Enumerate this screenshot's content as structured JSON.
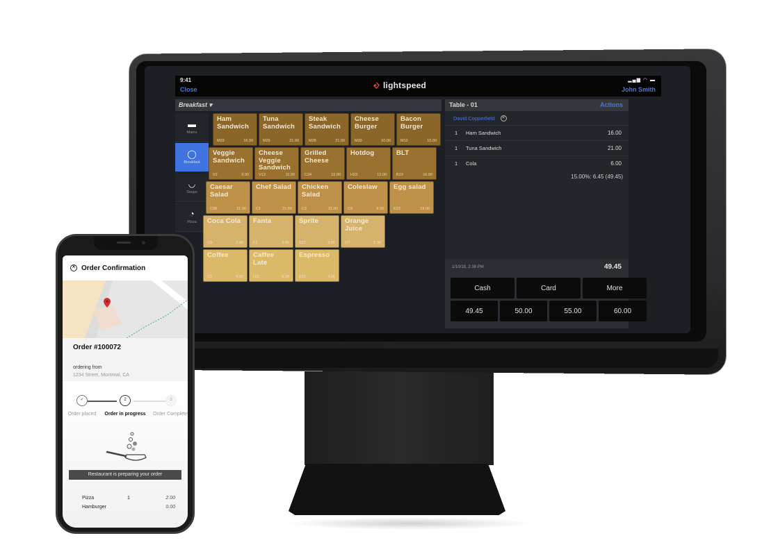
{
  "tablet": {
    "status_bar": {
      "time": "9:41",
      "icons": "signal-wifi-battery"
    },
    "header": {
      "close_label": "Close",
      "brand": "lightspeed",
      "user": "John Smith"
    },
    "menu": {
      "title": "Breakfast ▾"
    },
    "sidebar": {
      "items": [
        {
          "label": "Mains",
          "icon": "burger-icon",
          "glyph": "▬",
          "active": false
        },
        {
          "label": "Breakfast",
          "icon": "egg-icon",
          "glyph": "◯",
          "active": true
        },
        {
          "label": "Soups",
          "icon": "soup-bowl-icon",
          "glyph": "◡",
          "active": false
        },
        {
          "label": "Pizza",
          "icon": "pizza-icon",
          "glyph": "◔",
          "active": false
        }
      ]
    },
    "products": [
      [
        {
          "name": "Ham Sandwich",
          "code": "M23",
          "price": "16.00"
        },
        {
          "name": "Tuna Sandwich",
          "code": "M25",
          "price": "21.00"
        },
        {
          "name": "Steak Sandwich",
          "code": "M28",
          "price": "21.00"
        },
        {
          "name": "Cheese Burger",
          "code": "M39",
          "price": "10.00"
        },
        {
          "name": "Bacon Burger",
          "code": "M12",
          "price": "10.00"
        }
      ],
      [
        {
          "name": "Veggie Sandwich",
          "code": "V2",
          "price": "9.00"
        },
        {
          "name": "Cheese Veggie Sandwich",
          "code": "V13",
          "price": "11.00"
        },
        {
          "name": "Grilled Cheese",
          "code": "C34",
          "price": "12.00"
        },
        {
          "name": "Hotdog",
          "code": "H23",
          "price": "12.00"
        },
        {
          "name": "BLT",
          "code": "B19",
          "price": "16.00"
        }
      ],
      [
        {
          "name": "Caesar Salad",
          "code": "C99",
          "price": "21.00"
        },
        {
          "name": "Chef Salad",
          "code": "C1",
          "price": "21.50"
        },
        {
          "name": "Chicken Salad",
          "code": "C2",
          "price": "21.00"
        },
        {
          "name": "Coleslaw",
          "code": "C9",
          "price": "9.00"
        },
        {
          "name": "Egg salad",
          "code": "E23",
          "price": "19.00"
        }
      ],
      [
        {
          "name": "Coca Cola",
          "code": "C0",
          "price": "3.00"
        },
        {
          "name": "Fanta",
          "code": "F1",
          "price": "3.00"
        },
        {
          "name": "Sprite",
          "code": "S22",
          "price": "3.00"
        },
        {
          "name": "Orange Juice",
          "code": "O7",
          "price": "5.00"
        }
      ],
      [
        {
          "name": "Coffee",
          "code": "C0",
          "price": "4.00"
        },
        {
          "name": "Caffee Late",
          "code": "L01",
          "price": "6.00"
        },
        {
          "name": "Espresso",
          "code": "E01",
          "price": "4.00"
        }
      ]
    ],
    "order": {
      "table": "Table - 01",
      "actions_label": "Actions",
      "customer": "David Copperfield",
      "items": [
        {
          "qty": "1",
          "name": "Ham Sandwich",
          "price": "16.00"
        },
        {
          "qty": "1",
          "name": "Tuna Sandwich",
          "price": "21.00"
        },
        {
          "qty": "1",
          "name": "Cola",
          "price": "6.00"
        }
      ],
      "tax_line": "15.00%: 6.45 (49.45)",
      "timestamp": "1/10/18, 2:38 PM",
      "total": "49.45",
      "payment_methods": [
        "Cash",
        "Card",
        "More"
      ],
      "quick_amounts": [
        "49.45",
        "50.00",
        "55.00",
        "60.00"
      ]
    }
  },
  "phone": {
    "title": "Order Confirmation",
    "order_number": "Order #100072",
    "ordering_from_label": "ordering from",
    "address": "1234 Street, Montreal, CA",
    "steps": [
      {
        "num": "✓",
        "label": "Order placed",
        "state": "done"
      },
      {
        "num": "2",
        "label": "Order in progress",
        "state": "current"
      },
      {
        "num": "3",
        "label": "Order Complete!",
        "state": "pending"
      }
    ],
    "status_message": "Restaurant is preparing your order",
    "items": [
      {
        "name": "Pizza",
        "qty": "1",
        "price": "2.00"
      },
      {
        "name": "Hamburger",
        "qty": "",
        "price": "0.00"
      }
    ]
  },
  "colors": {
    "accent_blue": "#3f74e0",
    "link_blue": "#4a78d8",
    "brand_red": "#e0463a",
    "map_pin": "#d32f2f"
  }
}
